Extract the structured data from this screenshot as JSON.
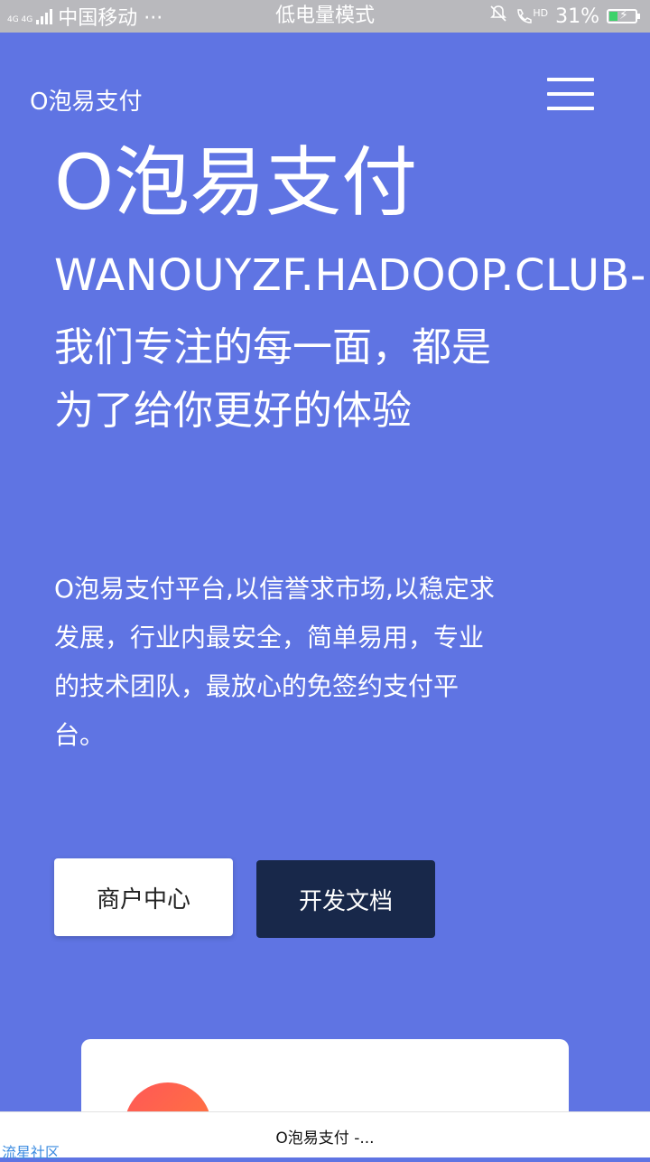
{
  "status_bar": {
    "network": "4G 4G",
    "carrier": "中国移动 ···",
    "mode": "低电量模式",
    "call_badge": "HD",
    "battery": "31%",
    "battery_level": 0.31
  },
  "nav": {
    "brand": "O泡易支付"
  },
  "hero": {
    "title": "O泡易支付",
    "domain": "WANOUYZF.HADOOP.CLUB-",
    "slogan": "我们专注的每一面，都是为了给你更好的体验",
    "description": "O泡易支付平台,以信誉求市场,以稳定求发展，行业内最安全，简单易用，专业的技术团队，最放心的免签约支付平台。"
  },
  "buttons": {
    "merchant": "商户中心",
    "docs": "开发文档"
  },
  "browser": {
    "tab_title": "O泡易支付 -..."
  },
  "watermark": "流星社区",
  "colors": {
    "background": "#5f74e3",
    "docs_button": "#18284a",
    "status_bar": "#b9b9bd"
  }
}
